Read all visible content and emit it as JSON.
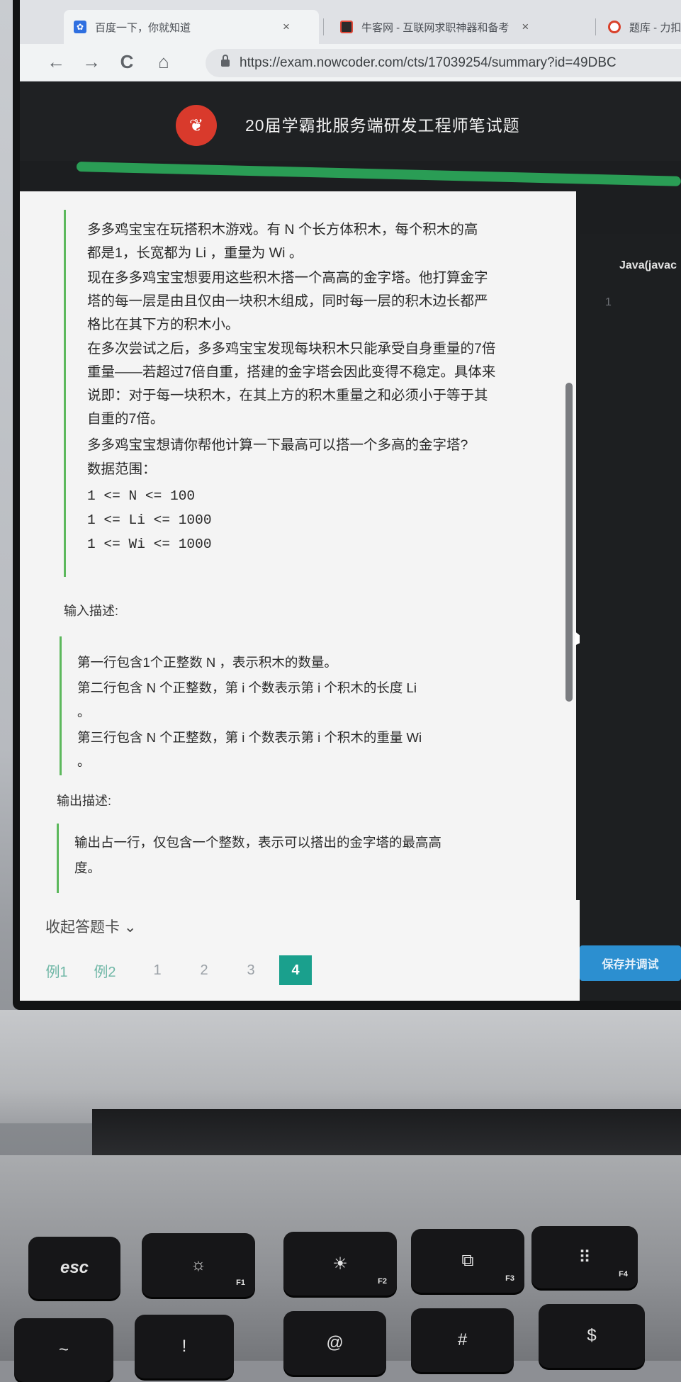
{
  "browser": {
    "tabs": [
      {
        "title": "百度一下，你就知道",
        "close": "×"
      },
      {
        "title": "牛客网 - 互联网求职神器和备考",
        "close": "×"
      },
      {
        "title": "题库 - 力扣 ("
      }
    ],
    "nav": {
      "back": "←",
      "forward": "→",
      "reload": "C",
      "home": "⌂"
    },
    "url": "https://exam.nowcoder.com/cts/17039254/summary?id=49DBC"
  },
  "header": {
    "exam_title": "20届学霸批服务端研发工程师笔试题"
  },
  "question": {
    "description_lines": [
      "多多鸡宝宝在玩搭积木游戏。有 N 个长方体积木，每个积木的高",
      "都是1，长宽都为 Li ，重量为 Wi 。",
      "现在多多鸡宝宝想要用这些积木搭一个高高的金字塔。他打算金字",
      "塔的每一层是由且仅由一块积木组成，同时每一层的积木边长都严",
      "格比在其下方的积木小。",
      "在多次尝试之后，多多鸡宝宝发现每块积木只能承受自身重量的7倍",
      "重量——若超过7倍自重，搭建的金字塔会因此变得不稳定。具体来",
      "说即：对于每一块积木，在其上方的积木重量之和必须小于等于其",
      "自重的7倍。",
      "多多鸡宝宝想请你帮他计算一下最高可以搭一个多高的金字塔?",
      "数据范围："
    ],
    "ranges": [
      "1 <= N <= 100",
      "1 <= Li <= 1000",
      "1 <= Wi <= 1000"
    ],
    "input_heading": "输入描述:",
    "input_lines": [
      "第一行包含1个正整数 N ，表示积木的数量。",
      "第二行包含 N 个正整数，第 i 个数表示第 i 个积木的长度 Li",
      "。",
      "第三行包含 N 个正整数，第 i 个数表示第 i 个积木的重量 Wi",
      "。"
    ],
    "output_heading": "输出描述:",
    "output_lines": [
      "输出占一行，仅包含一个整数，表示可以搭出的金字塔的最高高",
      "度。"
    ]
  },
  "answer_card": {
    "collapse_label": "收起答题卡 ⌄",
    "items": [
      "例1",
      "例2",
      "1",
      "2",
      "3",
      "4"
    ],
    "active": "4"
  },
  "editor": {
    "language": "Java(javac",
    "line_number": "1",
    "save_button": "保存并调试"
  },
  "keyboard": {
    "row1": [
      {
        "label": "esc",
        "sub": ""
      },
      {
        "label": "☼",
        "sub": "F1"
      },
      {
        "label": "☀",
        "sub": "F2"
      },
      {
        "label": "⧉",
        "sub": "F3"
      },
      {
        "label": "⠿",
        "sub": "F4"
      }
    ],
    "row2": [
      {
        "label": "~"
      },
      {
        "label": "!"
      },
      {
        "label": "@"
      },
      {
        "label": "#"
      },
      {
        "label": "$"
      }
    ]
  },
  "colors": {
    "accent_green": "#5cb85c",
    "active_page": "#1aa08d",
    "save_button": "#2c8fd0",
    "logo_red": "#d93a2c"
  }
}
